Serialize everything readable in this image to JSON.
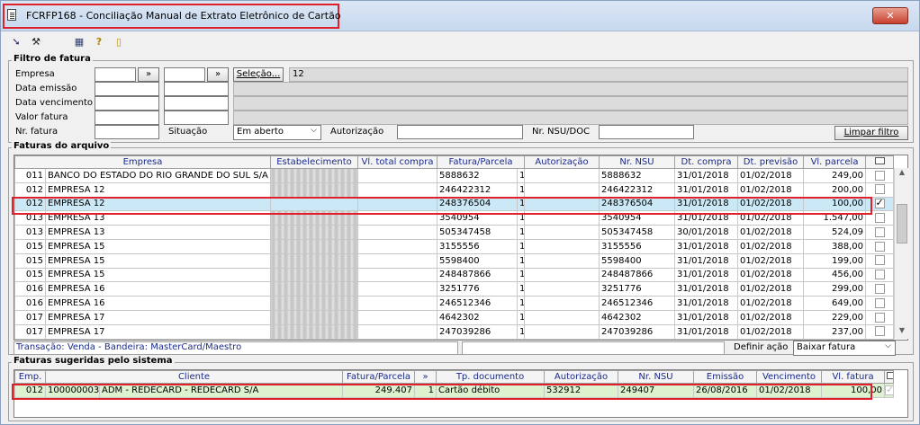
{
  "window": {
    "title": "FCRFP168 - Conciliação Manual de Extrato Eletrônico de Cartão",
    "close_label": "✕"
  },
  "filtro": {
    "section_title": "Filtro de fatura",
    "empresa_label": "Empresa",
    "empresa_from": "",
    "empresa_to": "",
    "browse_label": "»",
    "selecao_label": "Seleção...",
    "selecao_value": "12",
    "data_emissao_label": "Data emissão",
    "data_vencimento_label": "Data vencimento",
    "valor_fatura_label": "Valor fatura",
    "nr_fatura_label": "Nr. fatura",
    "situacao_label": "Situação",
    "situacao_value": "Em aberto",
    "autorizacao_label": "Autorização",
    "autorizacao_value": "",
    "nsu_label": "Nr. NSU/DOC",
    "nsu_value": "",
    "limpar_label": "Limpar filtro"
  },
  "faturas_arquivo": {
    "section_title": "Faturas do arquivo",
    "columns": [
      "Empresa",
      "Estabelecimento",
      "Vl. total compra",
      "Fatura/Parcela",
      "Autorização",
      "Nr. NSU",
      "Dt. compra",
      "Dt. previsão",
      "Vl. parcela"
    ],
    "rows": [
      {
        "cod": "011",
        "empresa": "BANCO DO ESTADO DO RIO GRANDE DO SUL S/A",
        "estab": "3",
        "total": "",
        "fatura": "5888632",
        "parcela": "1",
        "aut": "",
        "nsu": "5888632",
        "dt_compra": "31/01/2018",
        "dt_prev": "01/02/2018",
        "vl": "249,00",
        "checked": false
      },
      {
        "cod": "012",
        "empresa": "EMPRESA 12",
        "estab": "3",
        "total": "",
        "fatura": "246422312",
        "parcela": "1",
        "aut": "",
        "nsu": "246422312",
        "dt_compra": "31/01/2018",
        "dt_prev": "01/02/2018",
        "vl": "200,00",
        "checked": false
      },
      {
        "cod": "012",
        "empresa": "EMPRESA 12",
        "estab": "3",
        "total": "",
        "fatura": "248376504",
        "parcela": "1",
        "aut": "",
        "nsu": "248376504",
        "dt_compra": "31/01/2018",
        "dt_prev": "01/02/2018",
        "vl": "100,00",
        "checked": true
      },
      {
        "cod": "013",
        "empresa": "EMPRESA 13",
        "estab": "3",
        "total": "",
        "fatura": "3540954",
        "parcela": "1",
        "aut": "",
        "nsu": "3540954",
        "dt_compra": "31/01/2018",
        "dt_prev": "01/02/2018",
        "vl": "1.547,00",
        "checked": false
      },
      {
        "cod": "013",
        "empresa": "EMPRESA 13",
        "estab": "3",
        "total": "",
        "fatura": "505347458",
        "parcela": "1",
        "aut": "",
        "nsu": "505347458",
        "dt_compra": "30/01/2018",
        "dt_prev": "01/02/2018",
        "vl": "524,09",
        "checked": false
      },
      {
        "cod": "015",
        "empresa": "EMPRESA 15",
        "estab": "5",
        "total": "",
        "fatura": "3155556",
        "parcela": "1",
        "aut": "",
        "nsu": "3155556",
        "dt_compra": "31/01/2018",
        "dt_prev": "01/02/2018",
        "vl": "388,00",
        "checked": false
      },
      {
        "cod": "015",
        "empresa": "EMPRESA 15",
        "estab": "5",
        "total": "",
        "fatura": "5598400",
        "parcela": "1",
        "aut": "",
        "nsu": "5598400",
        "dt_compra": "31/01/2018",
        "dt_prev": "01/02/2018",
        "vl": "199,00",
        "checked": false
      },
      {
        "cod": "015",
        "empresa": "EMPRESA 15",
        "estab": "5",
        "total": "",
        "fatura": "248487866",
        "parcela": "1",
        "aut": "",
        "nsu": "248487866",
        "dt_compra": "31/01/2018",
        "dt_prev": "01/02/2018",
        "vl": "456,00",
        "checked": false
      },
      {
        "cod": "016",
        "empresa": "EMPRESA 16",
        "estab": "5",
        "total": "",
        "fatura": "3251776",
        "parcela": "1",
        "aut": "",
        "nsu": "3251776",
        "dt_compra": "31/01/2018",
        "dt_prev": "01/02/2018",
        "vl": "299,00",
        "checked": false
      },
      {
        "cod": "016",
        "empresa": "EMPRESA 16",
        "estab": "5",
        "total": "",
        "fatura": "246512346",
        "parcela": "1",
        "aut": "",
        "nsu": "246512346",
        "dt_compra": "31/01/2018",
        "dt_prev": "01/02/2018",
        "vl": "649,00",
        "checked": false
      },
      {
        "cod": "017",
        "empresa": "EMPRESA 17",
        "estab": "6",
        "total": "",
        "fatura": "4642302",
        "parcela": "1",
        "aut": "",
        "nsu": "4642302",
        "dt_compra": "31/01/2018",
        "dt_prev": "01/02/2018",
        "vl": "229,00",
        "checked": false
      },
      {
        "cod": "017",
        "empresa": "EMPRESA 17",
        "estab": "6",
        "total": "",
        "fatura": "247039286",
        "parcela": "1",
        "aut": "",
        "nsu": "247039286",
        "dt_compra": "31/01/2018",
        "dt_prev": "01/02/2018",
        "vl": "237,00",
        "checked": false
      }
    ],
    "transacao_text": "Transação: Venda - Bandeira: MasterCard/Maestro",
    "definir_acao_label": "Definir ação",
    "definir_acao_value": "Baixar fatura"
  },
  "faturas_sugeridas": {
    "section_title": "Faturas sugeridas pelo sistema",
    "columns": [
      "Emp.",
      "Cliente",
      "Fatura/Parcela",
      "»",
      "Tp. documento",
      "Autorização",
      "Nr. NSU",
      "Emissão",
      "Vencimento",
      "Vl. fatura"
    ],
    "rows": [
      {
        "emp": "012",
        "cliente_cod": "100000003",
        "cliente": "ADM - REDECARD - REDECARD S/A",
        "fatura": "249.407",
        "parcela": "1",
        "tp_doc": "Cartão débito",
        "aut": "532912",
        "nsu": "249407",
        "emissao": "26/08/2016",
        "venc": "01/02/2018",
        "vl": "100,00",
        "checked": true
      }
    ]
  }
}
